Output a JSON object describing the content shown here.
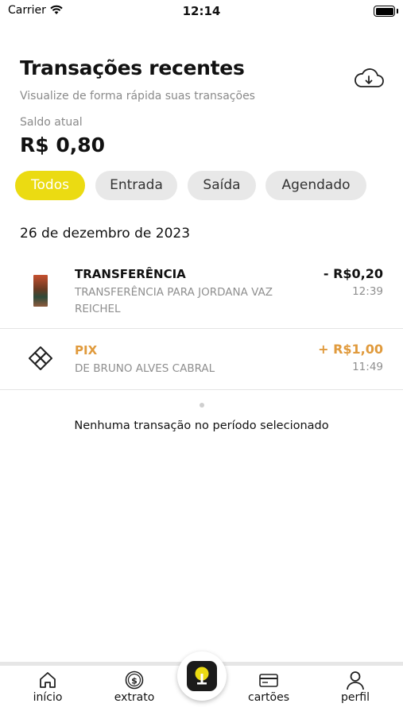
{
  "status_bar": {
    "carrier": "Carrier",
    "time": "12:14"
  },
  "header": {
    "title": "Transações recentes",
    "subtitle": "Visualize de forma rápida suas transações",
    "download_icon": "cloud-download-icon"
  },
  "balance": {
    "label": "Saldo atual",
    "value": "R$ 0,80"
  },
  "filters": [
    {
      "label": "Todos",
      "active": true
    },
    {
      "label": "Entrada",
      "active": false
    },
    {
      "label": "Saída",
      "active": false
    },
    {
      "label": "Agendado",
      "active": false
    }
  ],
  "date_group": "26 de dezembro de 2023",
  "transactions": [
    {
      "title": "TRANSFERÊNCIA",
      "description": "TRANSFERÊNCIA PARA JORDANA VAZ REICHEL",
      "amount": "- R$0,20",
      "time": "12:39",
      "color": "#111111"
    },
    {
      "title": "PIX",
      "description": "DE BRUNO ALVES CABRAL",
      "amount": "+ R$1,00",
      "time": "11:49",
      "color": "#e09a3c",
      "icon": "pix-icon"
    }
  ],
  "empty_message": "Nenhuma transação no período selecionado",
  "tabbar": {
    "items": [
      {
        "label": "início",
        "icon": "home-icon"
      },
      {
        "label": "extrato",
        "icon": "statement-icon"
      },
      {
        "label": "cartões",
        "icon": "card-icon"
      },
      {
        "label": "perfil",
        "icon": "profile-icon"
      }
    ],
    "center_icon": "app-logo-icon"
  },
  "colors": {
    "accent": "#ebdb12",
    "income": "#e09a3c",
    "muted": "#8f8f8f"
  }
}
